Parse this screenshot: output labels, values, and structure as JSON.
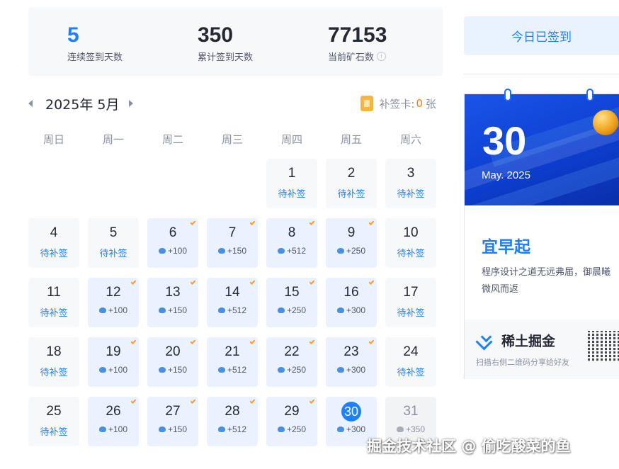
{
  "stats": [
    {
      "value": "5",
      "label": "连续签到天数",
      "highlight": true,
      "info": false
    },
    {
      "value": "350",
      "label": "累计签到天数",
      "highlight": false,
      "info": false
    },
    {
      "value": "77153",
      "label": "当前矿石数",
      "highlight": false,
      "info": true
    }
  ],
  "calendar": {
    "month_label": "2025年 5月",
    "makeup_card_label": "补签卡:",
    "makeup_card_count": "0",
    "makeup_card_unit": "张",
    "weekdays": [
      "周日",
      "周一",
      "周二",
      "周三",
      "周四",
      "周五",
      "周六"
    ],
    "leading_blanks": 4,
    "days": [
      {
        "day": "1",
        "state": "missed",
        "status": "待补签"
      },
      {
        "day": "2",
        "state": "missed",
        "status": "待补签"
      },
      {
        "day": "3",
        "state": "missed",
        "status": "待补签"
      },
      {
        "day": "4",
        "state": "missed",
        "status": "待补签"
      },
      {
        "day": "5",
        "state": "missed",
        "status": "待补签"
      },
      {
        "day": "6",
        "state": "signed",
        "reward": "+100"
      },
      {
        "day": "7",
        "state": "signed",
        "reward": "+150"
      },
      {
        "day": "8",
        "state": "signed",
        "reward": "+512"
      },
      {
        "day": "9",
        "state": "signed",
        "reward": "+250"
      },
      {
        "day": "10",
        "state": "missed",
        "status": "待补签"
      },
      {
        "day": "11",
        "state": "missed",
        "status": "待补签"
      },
      {
        "day": "12",
        "state": "signed",
        "reward": "+100"
      },
      {
        "day": "13",
        "state": "signed",
        "reward": "+150"
      },
      {
        "day": "14",
        "state": "signed",
        "reward": "+512"
      },
      {
        "day": "15",
        "state": "signed",
        "reward": "+250"
      },
      {
        "day": "16",
        "state": "signed",
        "reward": "+300"
      },
      {
        "day": "17",
        "state": "missed",
        "status": "待补签"
      },
      {
        "day": "18",
        "state": "missed",
        "status": "待补签"
      },
      {
        "day": "19",
        "state": "signed",
        "reward": "+100"
      },
      {
        "day": "20",
        "state": "signed",
        "reward": "+150"
      },
      {
        "day": "21",
        "state": "signed",
        "reward": "+512"
      },
      {
        "day": "22",
        "state": "signed",
        "reward": "+250"
      },
      {
        "day": "23",
        "state": "signed",
        "reward": "+300"
      },
      {
        "day": "24",
        "state": "missed",
        "status": "待补签"
      },
      {
        "day": "25",
        "state": "missed",
        "status": "待补签"
      },
      {
        "day": "26",
        "state": "signed",
        "reward": "+100"
      },
      {
        "day": "27",
        "state": "signed",
        "reward": "+150"
      },
      {
        "day": "28",
        "state": "signed",
        "reward": "+512"
      },
      {
        "day": "29",
        "state": "signed",
        "reward": "+250"
      },
      {
        "day": "30",
        "state": "today",
        "reward": "+300"
      },
      {
        "day": "31",
        "state": "future",
        "reward": "+350"
      }
    ]
  },
  "sidebar": {
    "signed_button": "今日已签到",
    "banner_day": "30",
    "banner_month": "May. 2025",
    "motto_title": "宜早起",
    "motto_text": "程序设计之道无远弗届，御晨曦微风而返",
    "brand_name": "稀土掘金",
    "brand_sub": "扫描右侧二维码分享给好友"
  },
  "watermark": "掘金技术社区 @ 偷吃酸菜的鱼",
  "colors": {
    "accent": "#1e80ff",
    "check": "#ff9a2e",
    "card_count": "#ff7d00"
  }
}
